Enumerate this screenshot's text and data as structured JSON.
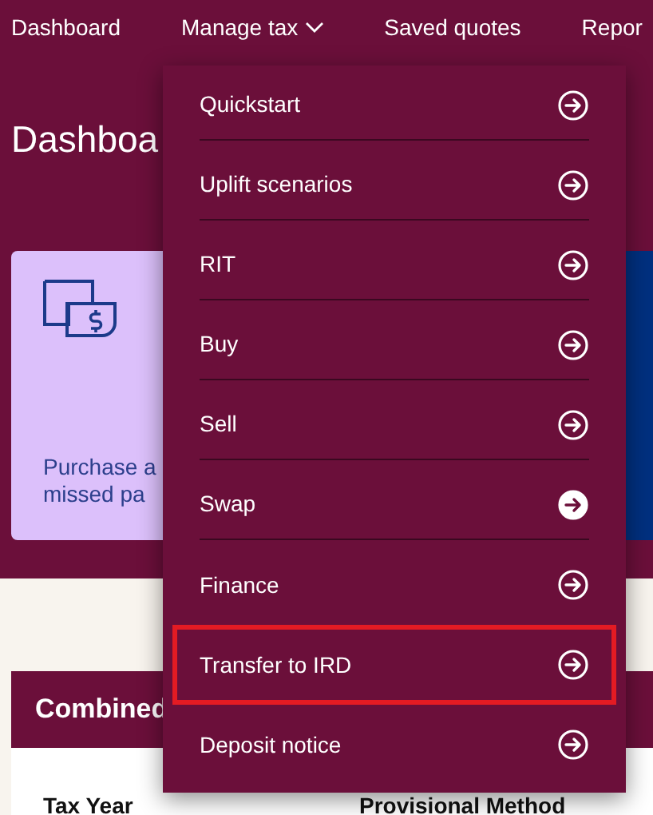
{
  "nav": [
    {
      "label": "Dashboard",
      "kind": "link"
    },
    {
      "label": "Manage tax",
      "kind": "dropdown"
    },
    {
      "label": "Saved quotes",
      "kind": "link"
    },
    {
      "label": "Repor",
      "kind": "link"
    }
  ],
  "page_title": "Dashboa",
  "card": {
    "text": "Purchase a\nmissed pa"
  },
  "table_card": {
    "title": "Combined",
    "columns": [
      "Tax Year",
      "Provisional Method"
    ]
  },
  "menu": [
    {
      "label": "Quickstart",
      "active": false,
      "highlighted": false
    },
    {
      "label": "Uplift scenarios",
      "active": false,
      "highlighted": false
    },
    {
      "label": "RIT",
      "active": false,
      "highlighted": false
    },
    {
      "label": "Buy",
      "active": false,
      "highlighted": false
    },
    {
      "label": "Sell",
      "active": false,
      "highlighted": false
    },
    {
      "label": "Swap",
      "active": true,
      "highlighted": false
    },
    {
      "label": "Finance",
      "active": false,
      "highlighted": false
    },
    {
      "label": "Transfer to IRD",
      "active": false,
      "highlighted": true
    },
    {
      "label": "Deposit notice",
      "active": false,
      "highlighted": false
    }
  ]
}
